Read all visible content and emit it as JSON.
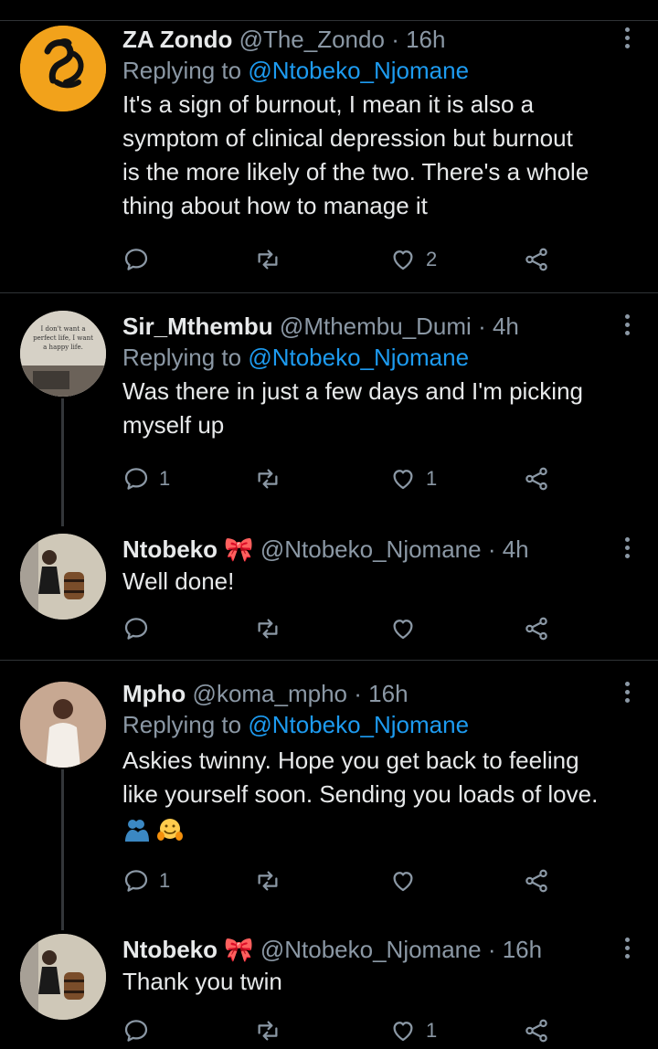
{
  "replies": [
    {
      "name": "ZA Zondo",
      "handle": "@The_Zondo",
      "time": "· 16h",
      "replying_prefix": "Replying to",
      "replying_to": "@Ntobeko_Njomane",
      "text_lines": [
        "It's a sign of burnout, I mean it is also a",
        "symptom of clinical depression but burnout",
        "is the more likely of the two. There's a whole",
        "thing about how to manage it"
      ],
      "reply_count": "",
      "retweet_count": "",
      "like_count": "2"
    },
    {
      "name": "Sir_Mthembu",
      "handle": "@Mthembu_Dumi",
      "time": "· 4h",
      "replying_prefix": "Replying to",
      "replying_to": "@Ntobeko_Njomane",
      "avatar_text": "I don't want a perfect life, I want a happy life.",
      "text_lines": [
        "Was there in just a few days and I'm picking",
        "myself up"
      ],
      "reply_count": "1",
      "retweet_count": "",
      "like_count": "1"
    },
    {
      "name": "Ntobeko",
      "name_emoji": "🎀",
      "handle": "@Ntobeko_Njomane",
      "time": "· 4h",
      "text_lines": [
        "Well done!"
      ],
      "reply_count": "",
      "retweet_count": "",
      "like_count": ""
    },
    {
      "name": "Mpho",
      "handle": "@koma_mpho",
      "time": "· 16h",
      "replying_prefix": "Replying to",
      "replying_to": "@Ntobeko_Njomane",
      "text_lines": [
        "Askies twinny. Hope you get back to feeling",
        "like yourself soon. Sending you loads of love."
      ],
      "emojis": [
        "people-hugging-icon",
        "hugging-face-icon"
      ],
      "reply_count": "1",
      "retweet_count": "",
      "like_count": ""
    },
    {
      "name": "Ntobeko",
      "name_emoji": "🎀",
      "handle": "@Ntobeko_Njomane",
      "time": "· 16h",
      "text_lines": [
        "Thank you twin"
      ],
      "reply_count": "",
      "retweet_count": "",
      "like_count": "1"
    }
  ],
  "colors": {
    "background": "#000000",
    "text": "#e7e9ea",
    "secondary": "#8b98a5",
    "link": "#1d9bf0",
    "divider": "#2f3336"
  }
}
